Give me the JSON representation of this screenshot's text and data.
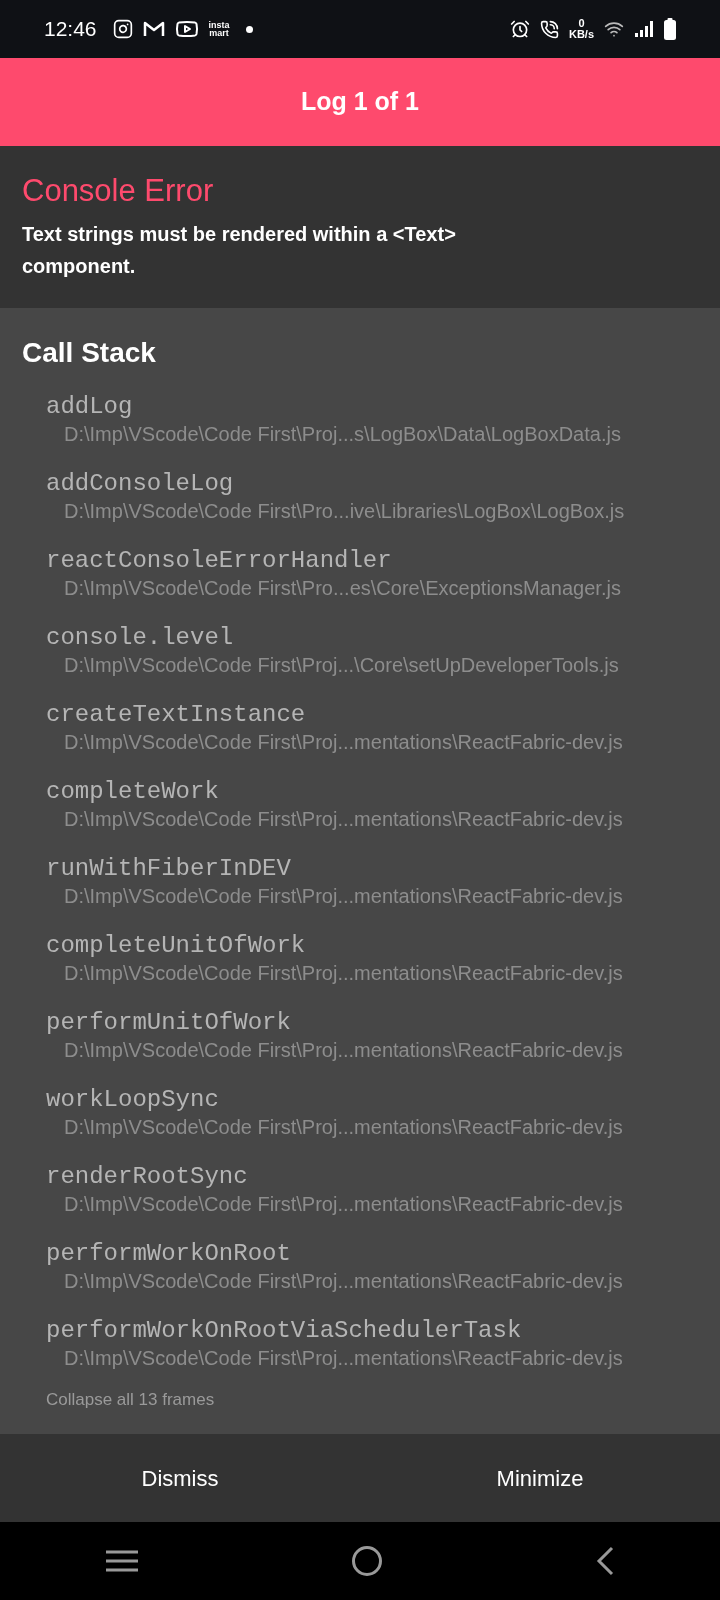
{
  "status_bar": {
    "time": "12:46",
    "app_badge": [
      "insta",
      "mart"
    ],
    "speed_value": "0",
    "speed_unit": "KB/s"
  },
  "header": {
    "title": "Log 1 of 1"
  },
  "error": {
    "title": "Console Error",
    "message": "Text strings must be rendered within a <Text> component."
  },
  "call_stack": {
    "title": "Call Stack",
    "frames": [
      {
        "method": "addLog",
        "location": "D:\\Imp\\VScode\\Code First\\Proj...s\\LogBox\\Data\\LogBoxData.js"
      },
      {
        "method": "addConsoleLog",
        "location": "D:\\Imp\\VScode\\Code First\\Pro...ive\\Libraries\\LogBox\\LogBox.js"
      },
      {
        "method": "reactConsoleErrorHandler",
        "location": "D:\\Imp\\VScode\\Code First\\Pro...es\\Core\\ExceptionsManager.js"
      },
      {
        "method": "console.level",
        "location": "D:\\Imp\\VScode\\Code First\\Proj...\\Core\\setUpDeveloperTools.js"
      },
      {
        "method": "createTextInstance",
        "location": "D:\\Imp\\VScode\\Code First\\Proj...mentations\\ReactFabric-dev.js"
      },
      {
        "method": "completeWork",
        "location": "D:\\Imp\\VScode\\Code First\\Proj...mentations\\ReactFabric-dev.js"
      },
      {
        "method": "runWithFiberInDEV",
        "location": "D:\\Imp\\VScode\\Code First\\Proj...mentations\\ReactFabric-dev.js"
      },
      {
        "method": "completeUnitOfWork",
        "location": "D:\\Imp\\VScode\\Code First\\Proj...mentations\\ReactFabric-dev.js"
      },
      {
        "method": "performUnitOfWork",
        "location": "D:\\Imp\\VScode\\Code First\\Proj...mentations\\ReactFabric-dev.js"
      },
      {
        "method": "workLoopSync",
        "location": "D:\\Imp\\VScode\\Code First\\Proj...mentations\\ReactFabric-dev.js"
      },
      {
        "method": "renderRootSync",
        "location": "D:\\Imp\\VScode\\Code First\\Proj...mentations\\ReactFabric-dev.js"
      },
      {
        "method": "performWorkOnRoot",
        "location": "D:\\Imp\\VScode\\Code First\\Proj...mentations\\ReactFabric-dev.js"
      },
      {
        "method": "performWorkOnRootViaSchedulerTask",
        "location": "D:\\Imp\\VScode\\Code First\\Proj...mentations\\ReactFabric-dev.js"
      }
    ],
    "collapse_link": "Collapse all 13 frames"
  },
  "actions": [
    "Dismiss",
    "Minimize"
  ]
}
